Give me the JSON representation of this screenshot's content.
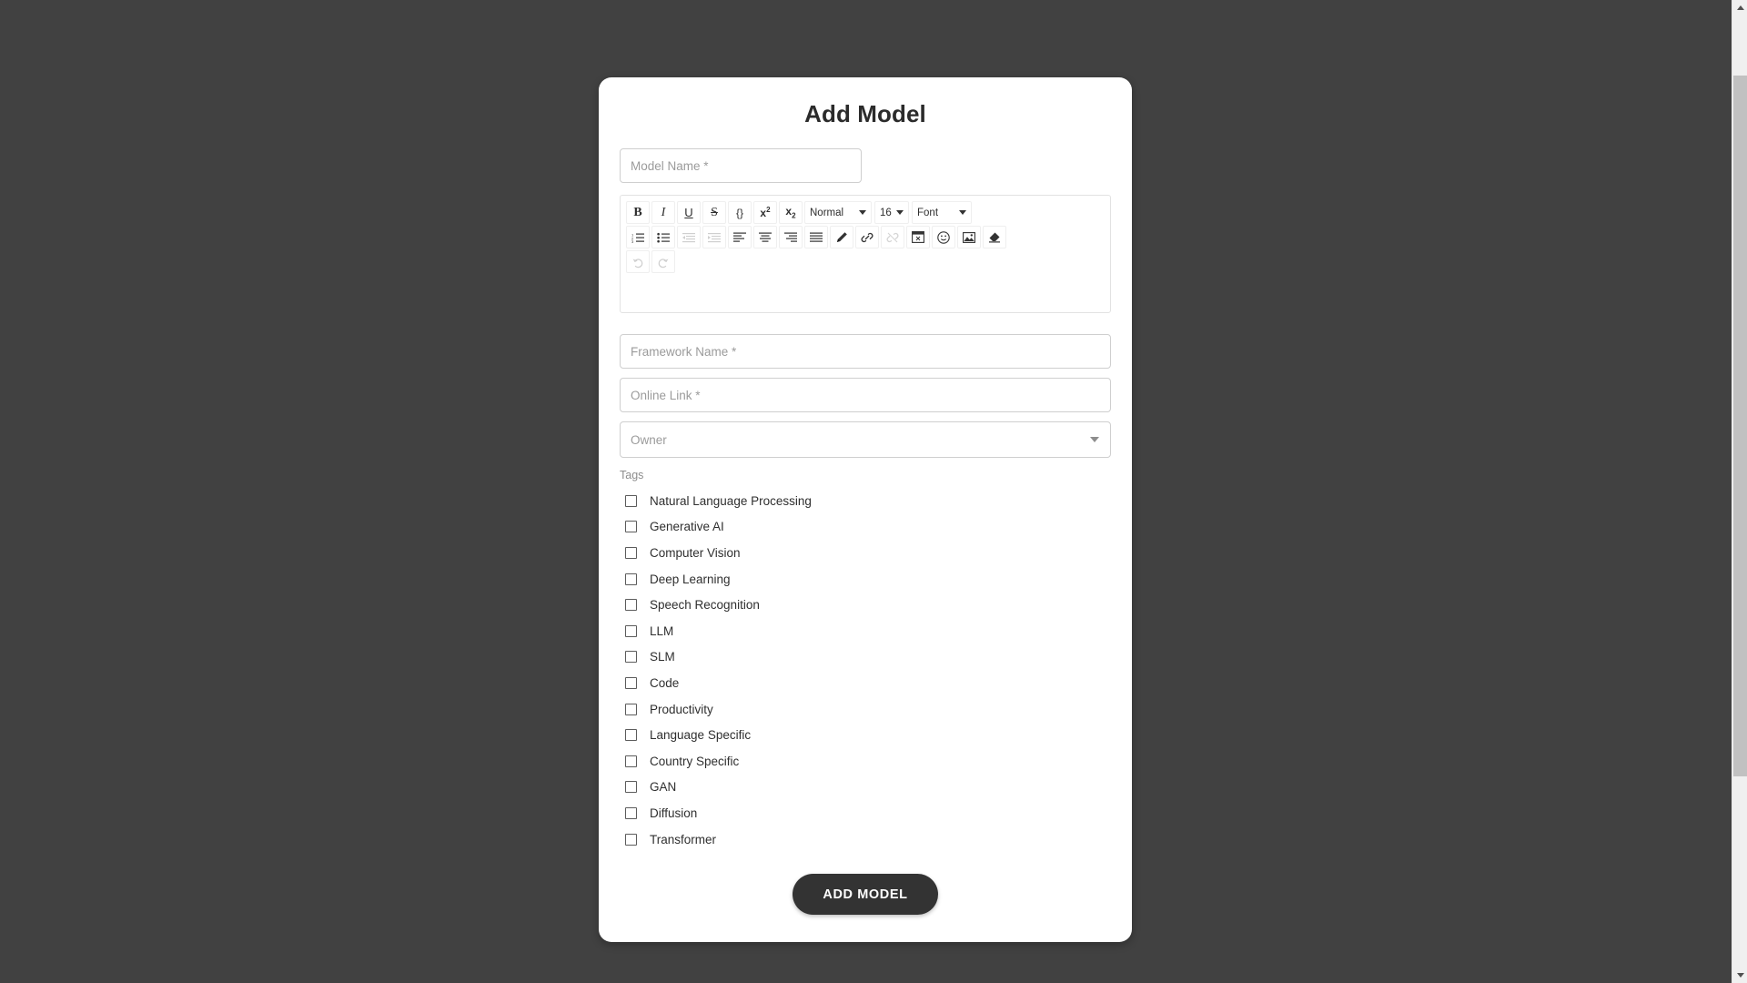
{
  "page": {
    "title": "Add Model",
    "background_color": "#414141",
    "card_background": "#ffffff"
  },
  "form": {
    "model_name": {
      "placeholder": "Model Name *",
      "value": ""
    },
    "framework_name": {
      "placeholder": "Framework Name *",
      "value": ""
    },
    "online_link": {
      "placeholder": "Online Link *",
      "value": ""
    },
    "owner": {
      "placeholder": "Owner",
      "selected": "",
      "caret_icon": "chevron-down-icon"
    }
  },
  "editor": {
    "content": "",
    "toolbar_row1": [
      {
        "name": "bold-icon",
        "label": "B"
      },
      {
        "name": "italic-icon",
        "label": "I"
      },
      {
        "name": "underline-icon",
        "label": "U"
      },
      {
        "name": "strikethrough-icon",
        "label": "S"
      },
      {
        "name": "code-block-icon",
        "label": "{}"
      },
      {
        "name": "superscript-icon",
        "label": "x²"
      },
      {
        "name": "subscript-icon",
        "label": "x₂"
      }
    ],
    "selects": [
      {
        "name": "heading-select",
        "value": "Normal"
      },
      {
        "name": "font-size-select",
        "value": "16"
      },
      {
        "name": "font-family-select",
        "value": "Font"
      }
    ],
    "toolbar_row2": [
      {
        "name": "ordered-list-icon",
        "dim": false
      },
      {
        "name": "unordered-list-icon",
        "dim": false
      },
      {
        "name": "outdent-icon",
        "dim": true
      },
      {
        "name": "indent-icon",
        "dim": true
      },
      {
        "name": "align-left-icon",
        "dim": false
      },
      {
        "name": "align-center-icon",
        "dim": false
      },
      {
        "name": "align-right-icon",
        "dim": false
      },
      {
        "name": "align-justify-icon",
        "dim": false
      },
      {
        "name": "text-color-pen-icon",
        "dim": false
      },
      {
        "name": "link-icon",
        "dim": false
      },
      {
        "name": "unlink-icon",
        "dim": true
      },
      {
        "name": "insert-table-icon",
        "dim": false
      },
      {
        "name": "emoji-icon",
        "dim": false
      },
      {
        "name": "insert-image-icon",
        "dim": false
      },
      {
        "name": "clear-format-eraser-icon",
        "dim": false
      }
    ],
    "toolbar_row3": [
      {
        "name": "undo-icon",
        "dim": true
      },
      {
        "name": "redo-icon",
        "dim": true
      }
    ]
  },
  "tags": {
    "label": "Tags",
    "items": [
      {
        "label": "Natural Language Processing",
        "checked": false
      },
      {
        "label": "Generative AI",
        "checked": false
      },
      {
        "label": "Computer Vision",
        "checked": false
      },
      {
        "label": "Deep Learning",
        "checked": false
      },
      {
        "label": "Speech Recognition",
        "checked": false
      },
      {
        "label": "LLM",
        "checked": false
      },
      {
        "label": "SLM",
        "checked": false
      },
      {
        "label": "Code",
        "checked": false
      },
      {
        "label": "Productivity",
        "checked": false
      },
      {
        "label": "Language Specific",
        "checked": false
      },
      {
        "label": "Country Specific",
        "checked": false
      },
      {
        "label": "GAN",
        "checked": false
      },
      {
        "label": "Diffusion",
        "checked": false
      },
      {
        "label": "Transformer",
        "checked": false
      }
    ]
  },
  "submit": {
    "label": "ADD MODEL",
    "background": "#333333"
  },
  "scrollbar": {
    "up_arrow": "triangle-up-icon",
    "down_arrow": "triangle-down-icon"
  }
}
